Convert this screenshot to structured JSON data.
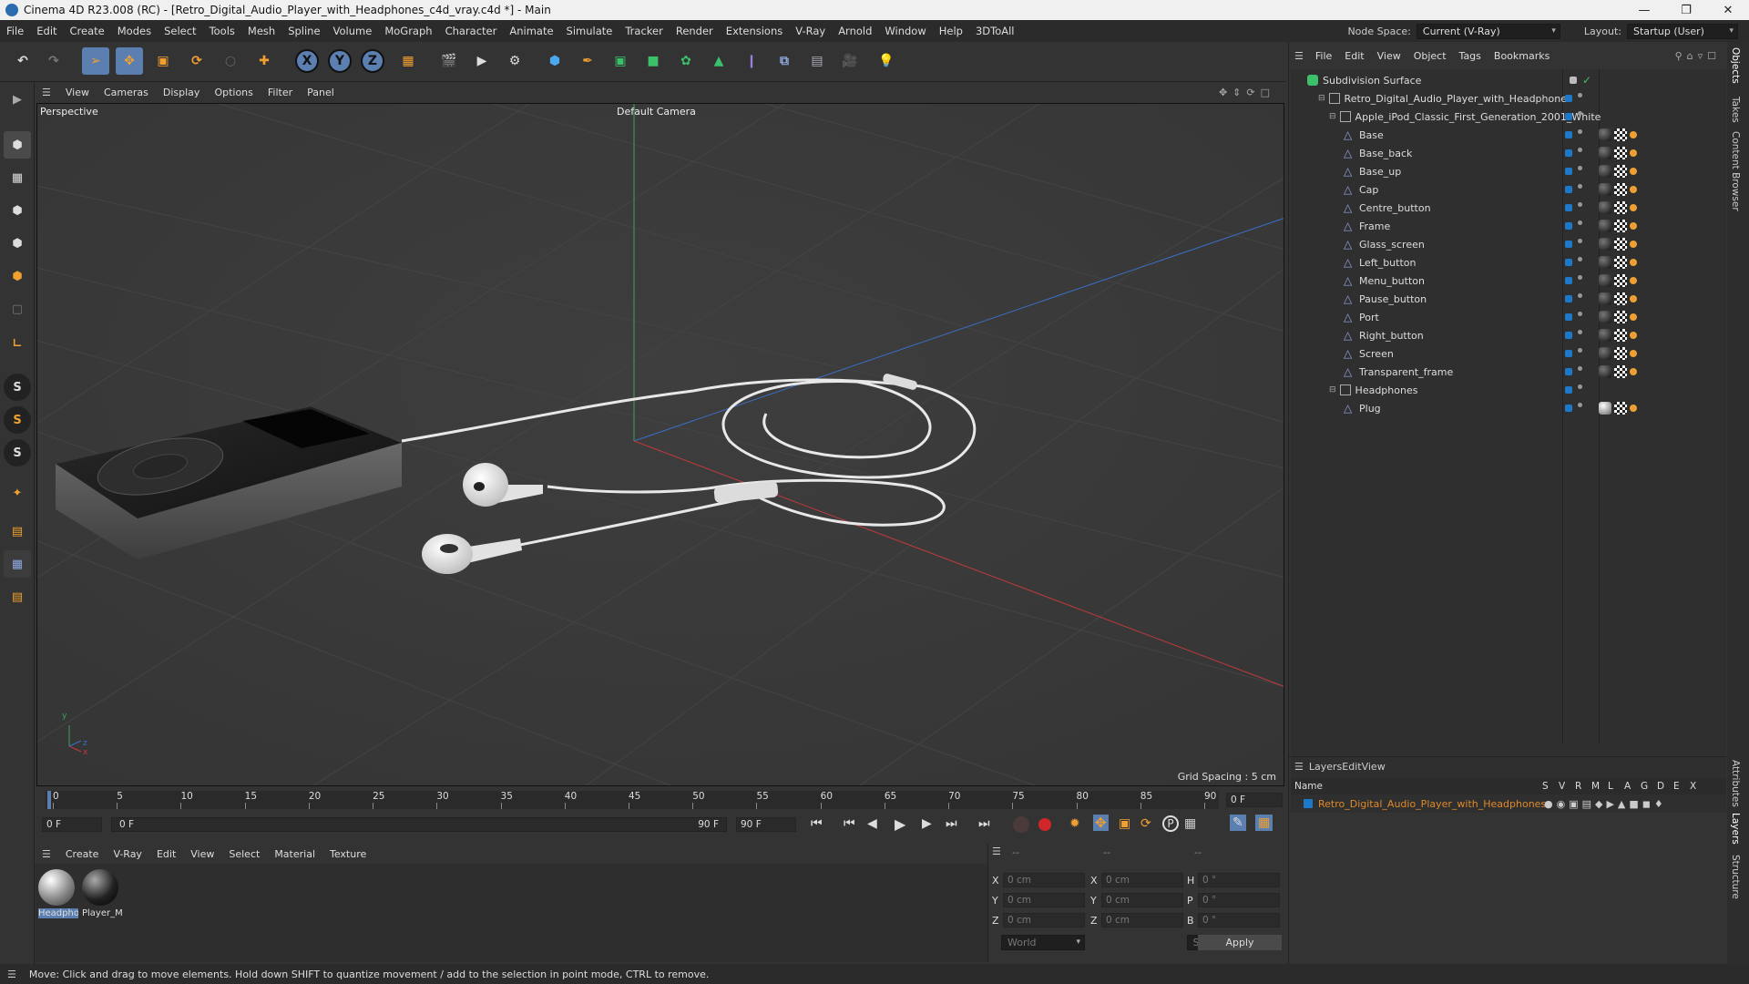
{
  "window": {
    "title": "Cinema 4D R23.008 (RC) - [Retro_Digital_Audio_Player_with_Headphones_c4d_vray.c4d *] - Main"
  },
  "menubar": {
    "items": [
      "File",
      "Edit",
      "Create",
      "Modes",
      "Select",
      "Tools",
      "Mesh",
      "Spline",
      "Volume",
      "MoGraph",
      "Character",
      "Animate",
      "Simulate",
      "Tracker",
      "Render",
      "Extensions",
      "V-Ray",
      "Arnold",
      "Window",
      "Help",
      "3DToAll"
    ],
    "node_space_label": "Node Space:",
    "node_space_value": "Current (V-Ray)",
    "layout_label": "Layout:",
    "layout_value": "Startup (User)"
  },
  "viewport": {
    "menu": [
      "View",
      "Cameras",
      "Display",
      "Options",
      "Filter",
      "Panel"
    ],
    "view_name": "Perspective",
    "camera": "Default Camera",
    "grid_spacing": "Grid Spacing : 5 cm"
  },
  "timeline": {
    "ticks": [
      "0",
      "5",
      "10",
      "15",
      "20",
      "25",
      "30",
      "35",
      "40",
      "45",
      "50",
      "55",
      "60",
      "65",
      "70",
      "75",
      "80",
      "85",
      "90"
    ],
    "current_frame": "0 F",
    "start_field": "0 F",
    "range_start": "0 F",
    "range_end": "90 F",
    "end_field": "90 F"
  },
  "material_manager": {
    "menu": [
      "Create",
      "V-Ray",
      "Edit",
      "View",
      "Select",
      "Material",
      "Texture"
    ],
    "materials": [
      "Headphones",
      "Player_M"
    ]
  },
  "coordinates": {
    "headers": [
      "--",
      "--",
      "--"
    ],
    "rows": [
      {
        "a": "X",
        "av": "0 cm",
        "b": "X",
        "bv": "0 cm",
        "c": "H",
        "cv": "0 °"
      },
      {
        "a": "Y",
        "av": "0 cm",
        "b": "Y",
        "bv": "0 cm",
        "c": "P",
        "cv": "0 °"
      },
      {
        "a": "Z",
        "av": "0 cm",
        "b": "Z",
        "bv": "0 cm",
        "c": "B",
        "cv": "0 °"
      }
    ],
    "world": "World",
    "scale": "Scale",
    "apply": "Apply"
  },
  "object_manager": {
    "menu": [
      "File",
      "Edit",
      "View",
      "Object",
      "Tags",
      "Bookmarks"
    ],
    "objects": [
      {
        "name": "Subdivision Surface",
        "depth": 0
      },
      {
        "name": "Retro_Digital_Audio_Player_with_Headphones",
        "depth": 1
      },
      {
        "name": "Apple_iPod_Classic_First_Generation_2001_White",
        "depth": 2
      },
      {
        "name": "Base",
        "depth": 3
      },
      {
        "name": "Base_back",
        "depth": 3
      },
      {
        "name": "Base_up",
        "depth": 3
      },
      {
        "name": "Cap",
        "depth": 3
      },
      {
        "name": "Centre_button",
        "depth": 3
      },
      {
        "name": "Frame",
        "depth": 3
      },
      {
        "name": "Glass_screen",
        "depth": 3
      },
      {
        "name": "Left_button",
        "depth": 3
      },
      {
        "name": "Menu_button",
        "depth": 3
      },
      {
        "name": "Pause_button",
        "depth": 3
      },
      {
        "name": "Port",
        "depth": 3
      },
      {
        "name": "Right_button",
        "depth": 3
      },
      {
        "name": "Screen",
        "depth": 3
      },
      {
        "name": "Transparent_frame",
        "depth": 3
      },
      {
        "name": "Headphones",
        "depth": 2
      },
      {
        "name": "Plug",
        "depth": 3
      }
    ]
  },
  "layer_manager": {
    "menu": [
      "Layers",
      "Edit",
      "View"
    ],
    "name_header": "Name",
    "columns": [
      "S",
      "V",
      "R",
      "M",
      "L",
      "A",
      "G",
      "D",
      "E",
      "X"
    ],
    "layer_name": "Retro_Digital_Audio_Player_with_Headphones"
  },
  "side_tabs": [
    "Objects",
    "Takes",
    "Content Browser",
    "Attributes",
    "Layers",
    "Structure"
  ],
  "statusbar": {
    "text": "Move: Click and drag to move elements. Hold down SHIFT to quantize movement / add to the selection in point mode, CTRL to remove."
  },
  "colors": {
    "accent": "#5b7fb0",
    "layer": "#e0892a",
    "object_blue": "#1e78c8"
  }
}
